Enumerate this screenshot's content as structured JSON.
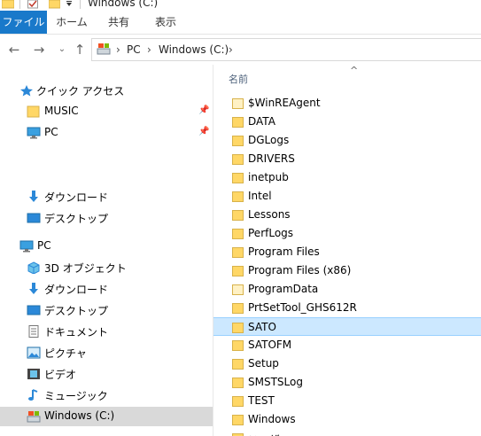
{
  "window": {
    "title": "Windows (C:)"
  },
  "ribbon": {
    "tabs": [
      "ファイル",
      "ホーム",
      "共有",
      "表示"
    ]
  },
  "address": {
    "crumbs": [
      "PC",
      "Windows (C:)"
    ]
  },
  "nav": {
    "quick_access": "クイック アクセス",
    "quick_items": [
      "MUSIC",
      "PC"
    ],
    "downloads": "ダウンロード",
    "desktop": "デスクトップ",
    "pc": "PC",
    "pc_items": [
      "3D オブジェクト",
      "ダウンロード",
      "デスクトップ",
      "ドキュメント",
      "ピクチャ",
      "ビデオ",
      "ミュージック",
      "Windows (C:)"
    ]
  },
  "content": {
    "column_name": "名前",
    "folders": [
      "$WinREAgent",
      "DATA",
      "DGLogs",
      "DRIVERS",
      "inetpub",
      "Intel",
      "Lessons",
      "PerfLogs",
      "Program Files",
      "Program Files (x86)",
      "ProgramData",
      "PrtSetTool_GHS612R",
      "SATO",
      "SATOFM",
      "Setup",
      "SMSTSLog",
      "TEST",
      "Windows",
      "ユーザー"
    ],
    "selected": "SATO"
  },
  "colors": {
    "accent": "#1979ca",
    "selection": "#cce8ff",
    "folder": "#ffd766",
    "nav_selected": "#d9d9d9"
  }
}
